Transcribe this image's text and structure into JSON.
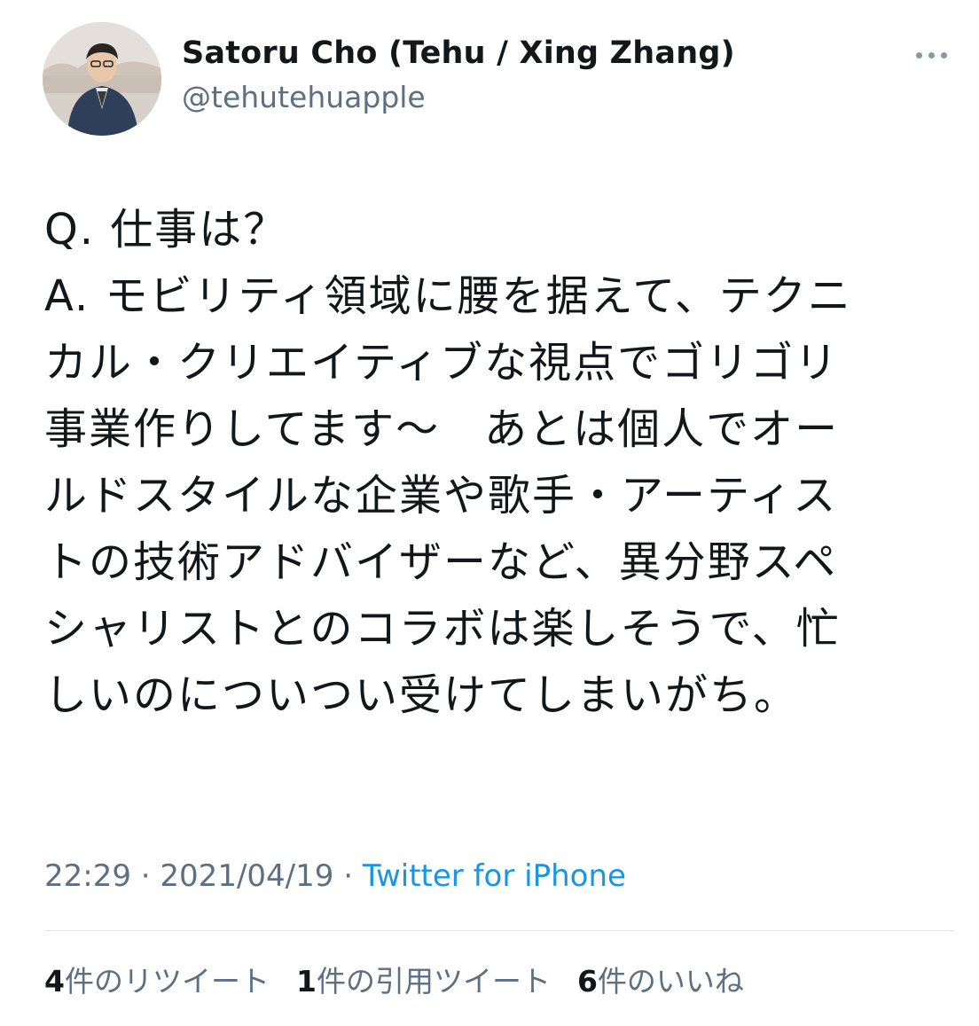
{
  "author": {
    "display_name": "Satoru Cho (Tehu / Xing Zhang)",
    "handle": "@tehutehuapple",
    "avatar_icon": "profile-photo"
  },
  "tweet": {
    "lines": [
      "Q. 仕事は？",
      "A. モビリティ領域に腰を据えて、テクニ",
      "カル・クリエイティブな視点でゴリゴリ",
      "事業作りしてます〜　あとは個人でオー",
      "ルドスタイルな企業や歌手・アーティス",
      "トの技術アドバイザーなど、異分野スペ",
      "シャリストとのコラボは楽しそうで、忙",
      "しいのについつい受けてしまいがち。"
    ]
  },
  "meta": {
    "time": "22:29",
    "separator1": " · ",
    "date": "2021/04/19",
    "separator2": " · ",
    "source": "Twitter for iPhone"
  },
  "stats": {
    "retweets": {
      "count": "4",
      "label": "件のリツイート"
    },
    "quotes": {
      "count": "1",
      "label": "件の引用ツイート"
    },
    "likes": {
      "count": "6",
      "label": "件のいいね"
    }
  },
  "colors": {
    "text": "#14171a",
    "secondary": "#5b7083",
    "link": "#1b95e0",
    "divider": "#e1e8ed"
  }
}
